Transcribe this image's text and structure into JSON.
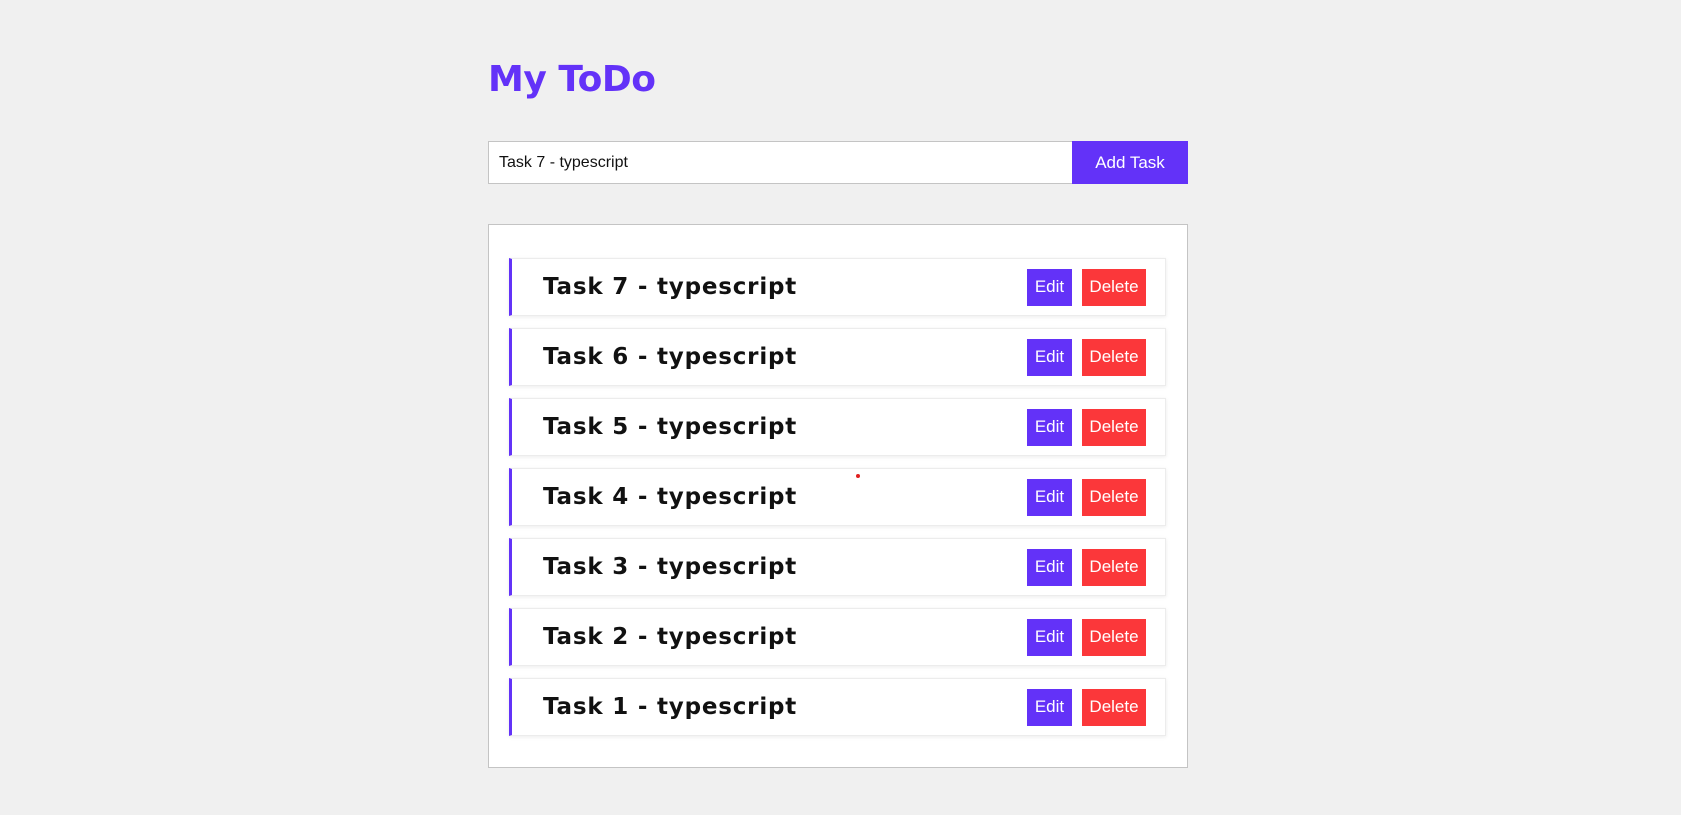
{
  "app": {
    "title": "My ToDo"
  },
  "form": {
    "input_value": "Task 7 - typescript",
    "add_label": "Add Task"
  },
  "tasks": [
    {
      "text": "Task 7 - typescript",
      "edit_label": "Edit",
      "delete_label": "Delete"
    },
    {
      "text": "Task 6 - typescript",
      "edit_label": "Edit",
      "delete_label": "Delete"
    },
    {
      "text": "Task 5 - typescript",
      "edit_label": "Edit",
      "delete_label": "Delete"
    },
    {
      "text": "Task 4 - typescript",
      "edit_label": "Edit",
      "delete_label": "Delete"
    },
    {
      "text": "Task 3 - typescript",
      "edit_label": "Edit",
      "delete_label": "Delete"
    },
    {
      "text": "Task 2 - typescript",
      "edit_label": "Edit",
      "delete_label": "Delete"
    },
    {
      "text": "Task 1 - typescript",
      "edit_label": "Edit",
      "delete_label": "Delete"
    }
  ],
  "colors": {
    "accent": "#6332f8",
    "danger": "#fb373a",
    "background": "#f0f0f0"
  }
}
